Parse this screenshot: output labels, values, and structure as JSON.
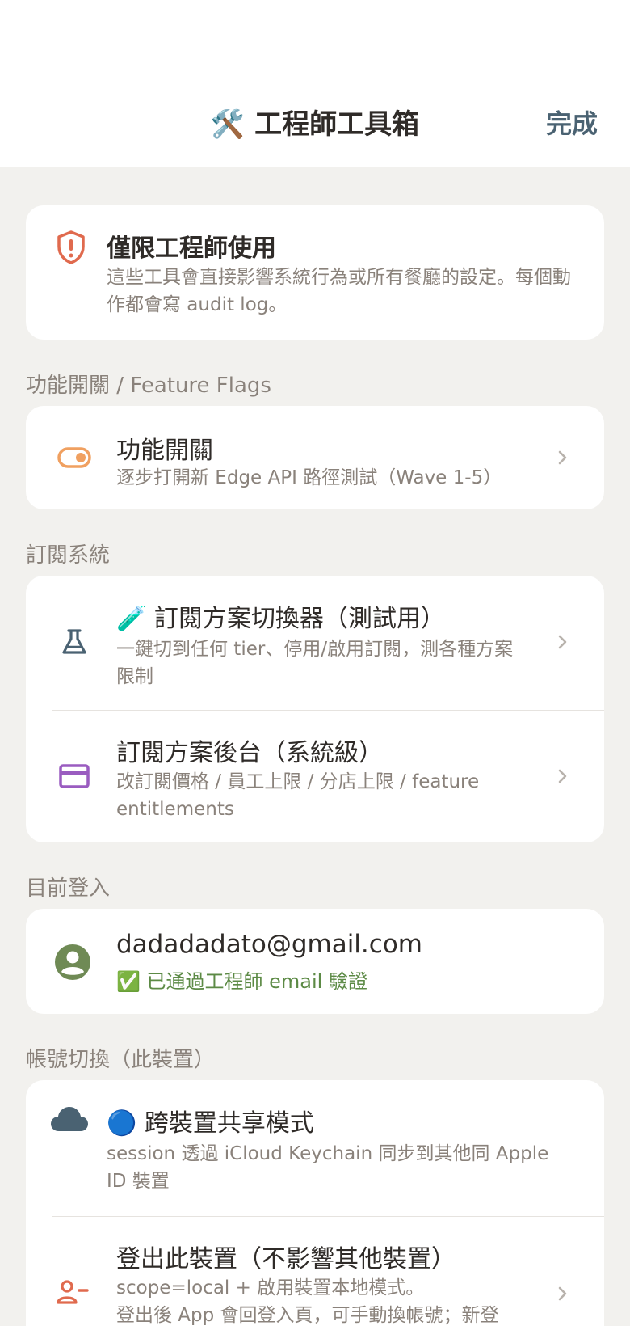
{
  "nav": {
    "title": "🛠️ 工程師工具箱",
    "done_label": "完成"
  },
  "warning": {
    "title": "僅限工程師使用",
    "body": "這些工具會直接影響系統行為或所有餐廳的設定。每個動作都會寫 audit log。",
    "icon": "shield-exclamation-icon",
    "color": "#e06a4e"
  },
  "sections": {
    "feature_flags": {
      "header": "功能開關 / Feature Flags",
      "item": {
        "title": "功能開關",
        "subtitle": "逐步打開新 Edge API 路徑測試（Wave 1-5）",
        "icon": "toggle-icon",
        "color": "#f0a060"
      }
    },
    "subscription": {
      "header": "訂閱系統",
      "items": [
        {
          "title": "🧪 訂閱方案切換器（測試用）",
          "subtitle": "一鍵切到任何 tier、停用/啟用訂閱，測各種方案限制",
          "icon": "flask-icon",
          "color": "#4a6272"
        },
        {
          "title": "訂閱方案後台（系統級）",
          "subtitle": "改訂閱價格 / 員工上限 / 分店上限 / feature entitlements",
          "icon": "credit-card-icon",
          "color": "#9a5cc0"
        }
      ]
    },
    "current_login": {
      "header": "目前登入",
      "email": "dadadadato@gmail.com",
      "verified": "✅ 已通過工程師 email 驗證",
      "icon": "account-circle-icon",
      "color": "#6f8a55"
    },
    "account_switch": {
      "header": "帳號切換（此裝置）",
      "items": [
        {
          "title": "🔵 跨裝置共享模式",
          "subtitle": "session 透過 iCloud Keychain 同步到其他同 Apple ID 裝置",
          "icon": "cloud-icon",
          "color": "#4a6272"
        },
        {
          "title": "登出此裝置（不影響其他裝置）",
          "subtitle_line1": "scope=local + 啟用裝置本地模式。",
          "subtitle_line2": "登出後 App 會回登入頁，可手動換帳號；新登",
          "icon": "person-remove-icon",
          "color": "#e06a4e"
        }
      ]
    }
  },
  "colors": {
    "background": "#f2f1ee",
    "card": "#ffffff",
    "secondary_text": "#8a827b",
    "chevron": "#b8b2ac"
  }
}
